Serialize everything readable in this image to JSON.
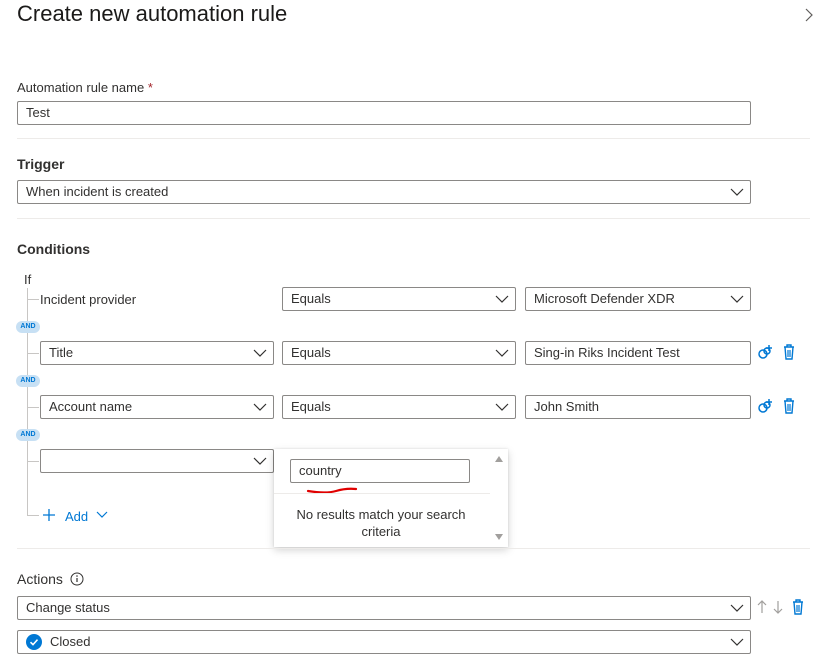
{
  "header": {
    "title": "Create new automation rule"
  },
  "rule_name": {
    "label": "Automation rule name",
    "required_mark": "*",
    "value": "Test"
  },
  "trigger": {
    "title": "Trigger",
    "value": "When incident is created"
  },
  "conditions": {
    "title": "Conditions",
    "if_label": "If",
    "and_label": "AND",
    "rows": [
      {
        "property": "Incident provider",
        "operator": "Equals",
        "value": "Microsoft Defender XDR"
      },
      {
        "property": "Title",
        "operator": "Equals",
        "value": "Sing-in Riks Incident Test"
      },
      {
        "property": "Account name",
        "operator": "Equals",
        "value": "John Smith"
      },
      {
        "property": ""
      }
    ],
    "add_label": "Add"
  },
  "property_search": {
    "query": "country",
    "no_results_line1": "No results match your search",
    "no_results_line2": "criteria"
  },
  "actions": {
    "title": "Actions",
    "action_value": "Change status",
    "status_value": "Closed"
  },
  "colors": {
    "accent": "#0078d4",
    "annotation": "#e00000"
  }
}
